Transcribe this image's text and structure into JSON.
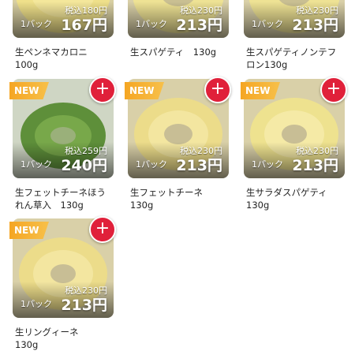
{
  "colors": {
    "new_badge": "#f5a623",
    "add_button": "#e0203a"
  },
  "products": [
    {
      "name": "生ペンネマカロニ\n100g",
      "tax_price": "税込180円",
      "unit": "1パック",
      "price": "167円",
      "is_new": false,
      "noodle": "penne"
    },
    {
      "name": "生スパゲティ　130g",
      "tax_price": "税込230円",
      "unit": "1パック",
      "price": "213円",
      "is_new": false,
      "noodle": "yellow"
    },
    {
      "name": "生スパゲティノンテフロン130g",
      "tax_price": "税込230円",
      "unit": "1パック",
      "price": "213円",
      "is_new": false,
      "noodle": "yellow"
    },
    {
      "name": "生フェットチーネほうれん草入　130g",
      "tax_price": "税込259円",
      "unit": "1パック",
      "price": "240円",
      "is_new": true,
      "badge": "NEW",
      "noodle": "spinach"
    },
    {
      "name": "生フェットチーネ\n130g",
      "tax_price": "税込230円",
      "unit": "1パック",
      "price": "213円",
      "is_new": true,
      "badge": "NEW",
      "noodle": "yellow"
    },
    {
      "name": "生サラダスパゲティ\n130g",
      "tax_price": "税込230円",
      "unit": "1パック",
      "price": "213円",
      "is_new": true,
      "badge": "NEW",
      "noodle": "yellow"
    },
    {
      "name": "生リングィーネ\n130g",
      "tax_price": "税込230円",
      "unit": "1パック",
      "price": "213円",
      "is_new": true,
      "badge": "NEW",
      "noodle": "yellow"
    }
  ],
  "add_icon": "plus-icon"
}
